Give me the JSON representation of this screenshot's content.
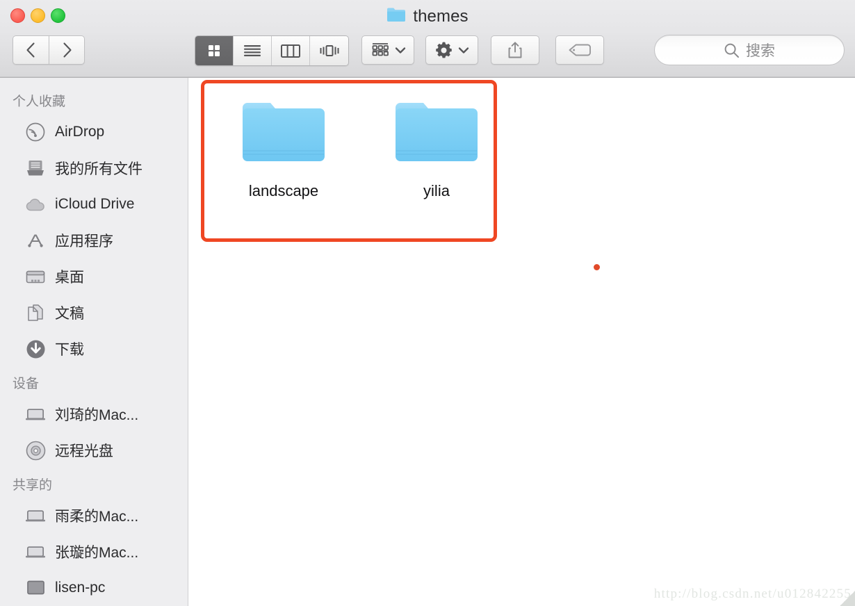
{
  "window": {
    "title": "themes",
    "title_icon": "folder-icon",
    "traffic_lights": [
      {
        "name": "close-button",
        "color": "#fa5c52"
      },
      {
        "name": "minimize-button",
        "color": "#fdbc2c"
      },
      {
        "name": "maximize-button",
        "color": "#22c33c"
      }
    ]
  },
  "toolbar": {
    "back_icon": "chevron-left-icon",
    "forward_icon": "chevron-right-icon",
    "view_modes": [
      {
        "name": "icon-view",
        "icon": "grid-icon",
        "active": true
      },
      {
        "name": "list-view",
        "icon": "list-icon",
        "active": false
      },
      {
        "name": "column-view",
        "icon": "columns-icon",
        "active": false
      },
      {
        "name": "coverflow-view",
        "icon": "coverflow-icon",
        "active": false
      }
    ],
    "arrange_icon": "arrange-grid-icon",
    "action_icon": "gear-icon",
    "dropdown_icon": "chevron-down-icon",
    "share_icon": "share-icon",
    "tag_icon": "tag-icon"
  },
  "search": {
    "icon": "search-icon",
    "placeholder": "搜索",
    "value": ""
  },
  "sidebar": {
    "sections": [
      {
        "title": "个人收藏",
        "items": [
          {
            "label": "AirDrop",
            "icon": "airdrop-icon"
          },
          {
            "label": "我的所有文件",
            "icon": "all-files-icon"
          },
          {
            "label": "iCloud Drive",
            "icon": "cloud-icon"
          },
          {
            "label": "应用程序",
            "icon": "applications-icon"
          },
          {
            "label": "桌面",
            "icon": "desktop-icon"
          },
          {
            "label": "文稿",
            "icon": "documents-icon"
          },
          {
            "label": "下载",
            "icon": "downloads-icon"
          }
        ]
      },
      {
        "title": "设备",
        "items": [
          {
            "label": "刘琦的Mac...",
            "icon": "laptop-icon"
          },
          {
            "label": "远程光盘",
            "icon": "disc-icon"
          }
        ]
      },
      {
        "title": "共享的",
        "items": [
          {
            "label": "雨柔的Mac...",
            "icon": "laptop-icon"
          },
          {
            "label": "张璇的Mac...",
            "icon": "laptop-icon"
          },
          {
            "label": "lisen-pc",
            "icon": "monitor-icon"
          }
        ]
      }
    ]
  },
  "content": {
    "files": [
      {
        "name": "landscape",
        "icon": "folder-icon",
        "type": "folder"
      },
      {
        "name": "yilia",
        "icon": "folder-icon",
        "type": "folder"
      }
    ]
  },
  "annotations": {
    "highlight_color": "#ef4723",
    "dot_color": "#e14a2a"
  },
  "watermark": {
    "text": "http://blog.csdn.net/u012842255"
  }
}
